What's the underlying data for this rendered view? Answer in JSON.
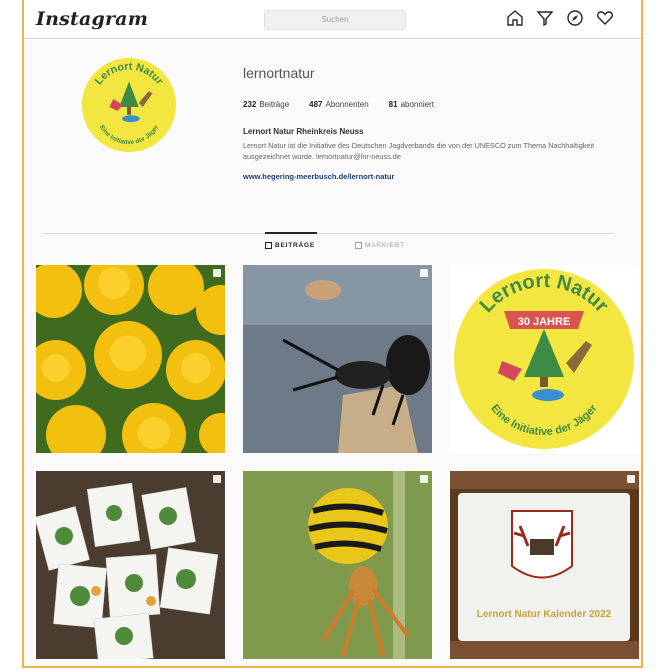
{
  "app": {
    "logo_text": "Instagram"
  },
  "search": {
    "placeholder": "Suchen"
  },
  "nav": {
    "icons": [
      "home-icon",
      "explore-icon",
      "compass-icon",
      "heart-icon"
    ]
  },
  "profile": {
    "username": "lernortnatur",
    "logo_lines": [
      "Lernort Natur",
      "Eine Initiative der Jäger"
    ],
    "stats": [
      {
        "count": "232",
        "label": "Beiträge"
      },
      {
        "count": "487",
        "label": "Abonnenten"
      },
      {
        "count": "81",
        "label": "abonniert"
      }
    ],
    "bio_name": "Lernort Natur Rheinkreis Neuss",
    "bio_text": "Lernort Natur ist die Initiative des Deutschen Jagdverbands die von der UNESCO zum Thema Nachhaltigkeit ausgezeichnet wurde. lernortnatur@lnr-neuss.de",
    "bio_link": "www.hegering-meerbusch.de/lernort-natur"
  },
  "tabs": [
    {
      "label": "BEITRÄGE",
      "active": true
    },
    {
      "label": "MARKIERT",
      "active": false
    }
  ],
  "posts": [
    {
      "subject": "yellow-flowers"
    },
    {
      "subject": "stag-beetle"
    },
    {
      "subject": "lernort-natur-30-jahre-logo",
      "texts": [
        "Lernort Natur",
        "30 JAHRE",
        "Eine Initiative der Jäger"
      ]
    },
    {
      "subject": "leaf-cards"
    },
    {
      "subject": "wasp-spider"
    },
    {
      "subject": "calendar-sign",
      "texts": [
        "Lernort Natur Kalender 2022"
      ]
    }
  ],
  "colors": {
    "accent": "#f0b24a",
    "link": "#1f3d78",
    "logo_yellow": "#f3e640",
    "logo_green": "#3d8b45"
  }
}
